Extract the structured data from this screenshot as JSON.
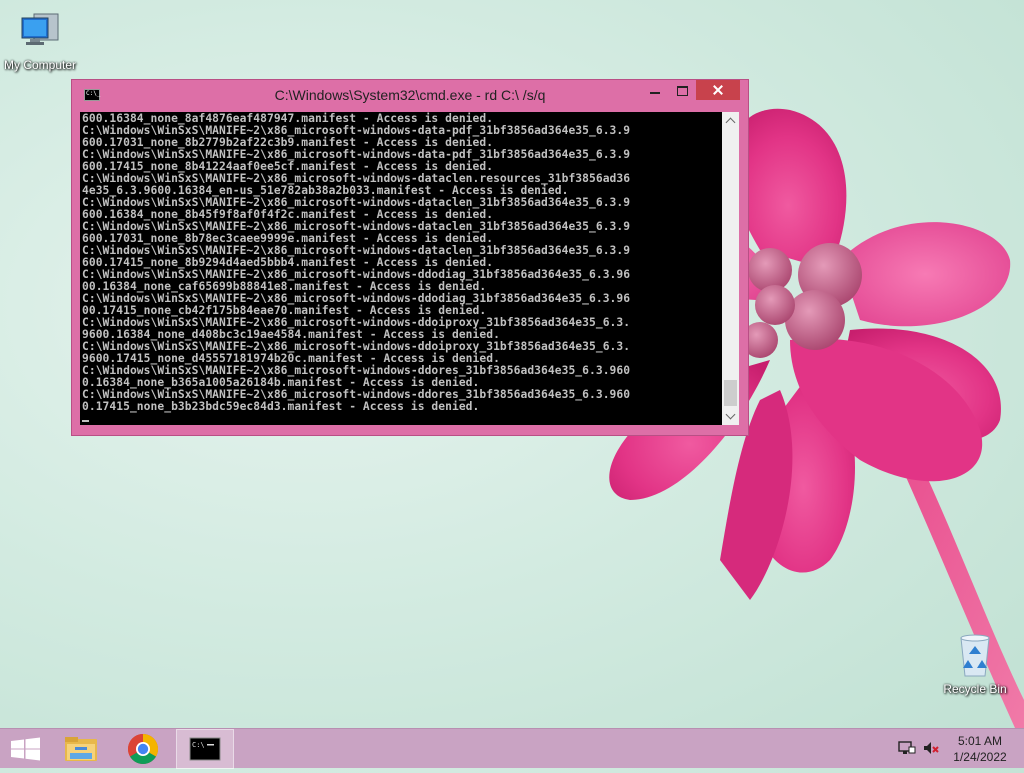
{
  "desktop": {
    "icons": [
      {
        "label": "My Computer",
        "icon": "computer-icon"
      },
      {
        "label": "Recycle Bin",
        "icon": "recycle-bin-icon"
      }
    ]
  },
  "cmd_window": {
    "title": "C:\\Windows\\System32\\cmd.exe - rd  C:\\ /s/q",
    "icon": "cmd-icon",
    "icon_text": "C:\\_",
    "buttons": {
      "minimize": "minimize-icon",
      "maximize": "maximize-icon",
      "close": "close-icon"
    },
    "colors": {
      "frame": "#dd6fa7",
      "close_button": "#c8424c",
      "console_bg": "#000000",
      "console_text": "#c0c0c0"
    },
    "lines": [
      "600.16384_none_8af4876eaf487947.manifest - Access is denied.",
      "C:\\Windows\\WinSxS\\MANIFE~2\\x86_microsoft-windows-data-pdf_31bf3856ad364e35_6.3.9",
      "600.17031_none_8b2779b2af22c3b9.manifest - Access is denied.",
      "C:\\Windows\\WinSxS\\MANIFE~2\\x86_microsoft-windows-data-pdf_31bf3856ad364e35_6.3.9",
      "600.17415_none_8b41224aaf0ee5cf.manifest - Access is denied.",
      "C:\\Windows\\WinSxS\\MANIFE~2\\x86_microsoft-windows-dataclen.resources_31bf3856ad36",
      "4e35_6.3.9600.16384_en-us_51e782ab38a2b033.manifest - Access is denied.",
      "C:\\Windows\\WinSxS\\MANIFE~2\\x86_microsoft-windows-dataclen_31bf3856ad364e35_6.3.9",
      "600.16384_none_8b45f9f8af0f4f2c.manifest - Access is denied.",
      "C:\\Windows\\WinSxS\\MANIFE~2\\x86_microsoft-windows-dataclen_31bf3856ad364e35_6.3.9",
      "600.17031_none_8b78ec3caee9999e.manifest - Access is denied.",
      "C:\\Windows\\WinSxS\\MANIFE~2\\x86_microsoft-windows-dataclen_31bf3856ad364e35_6.3.9",
      "600.17415_none_8b9294d4aed5bbb4.manifest - Access is denied.",
      "C:\\Windows\\WinSxS\\MANIFE~2\\x86_microsoft-windows-ddodiag_31bf3856ad364e35_6.3.96",
      "00.16384_none_caf65699b88841e8.manifest - Access is denied.",
      "C:\\Windows\\WinSxS\\MANIFE~2\\x86_microsoft-windows-ddodiag_31bf3856ad364e35_6.3.96",
      "00.17415_none_cb42f175b84eae70.manifest - Access is denied.",
      "C:\\Windows\\WinSxS\\MANIFE~2\\x86_microsoft-windows-ddoiproxy_31bf3856ad364e35_6.3.",
      "9600.16384_none_d408bc3c19ae4584.manifest - Access is denied.",
      "C:\\Windows\\WinSxS\\MANIFE~2\\x86_microsoft-windows-ddoiproxy_31bf3856ad364e35_6.3.",
      "9600.17415_none_d45557181974b20c.manifest - Access is denied.",
      "C:\\Windows\\WinSxS\\MANIFE~2\\x86_microsoft-windows-ddores_31bf3856ad364e35_6.3.960",
      "0.16384_none_b365a1005a26184b.manifest - Access is denied.",
      "C:\\Windows\\WinSxS\\MANIFE~2\\x86_microsoft-windows-ddores_31bf3856ad364e35_6.3.960",
      "0.17415_none_b3b23bdc59ec84d3.manifest - Access is denied."
    ]
  },
  "taskbar": {
    "color": "#c9a3c3",
    "items": [
      {
        "icon": "windows-start-icon"
      },
      {
        "icon": "file-explorer-icon"
      },
      {
        "icon": "chrome-icon"
      },
      {
        "icon": "cmd-icon",
        "active": true
      }
    ],
    "tray": [
      {
        "icon": "network-icon"
      },
      {
        "icon": "volume-muted-icon"
      }
    ],
    "clock": {
      "time": "5:01 AM",
      "date": "1/24/2022"
    }
  }
}
